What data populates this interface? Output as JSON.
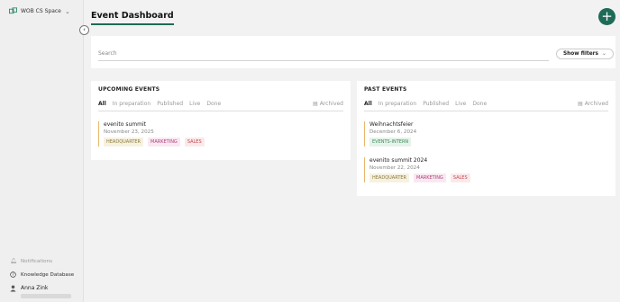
{
  "sidebar": {
    "workspace_name": "WOB CS Space",
    "links": {
      "notifications": "Notifications",
      "knowledge": "Knowledge Database"
    },
    "user": {
      "name": "Anna Zink"
    }
  },
  "header": {
    "title": "Event Dashboard"
  },
  "search": {
    "placeholder": "Search",
    "filters_label": "Show filters"
  },
  "upcoming": {
    "title": "UPCOMING EVENTS",
    "tabs": [
      "All",
      "In preparation",
      "Published",
      "Live",
      "Done"
    ],
    "archived_label": "Archived",
    "events": [
      {
        "title": "evenito summit",
        "date": "November 23, 2025",
        "tags": [
          "HEADQUARTER",
          "MARKETING",
          "SALES"
        ]
      }
    ]
  },
  "past": {
    "title": "PAST EVENTS",
    "tabs": [
      "All",
      "In preparation",
      "Published",
      "Live",
      "Done"
    ],
    "archived_label": "Archived",
    "events": [
      {
        "title": "Weihnachtsfeier",
        "date": "December 6, 2024",
        "tags": [
          "EVENTS-INTERN"
        ]
      },
      {
        "title": "evenito summit 2024",
        "date": "November 22, 2024",
        "tags": [
          "HEADQUARTER",
          "MARKETING",
          "SALES"
        ]
      }
    ]
  },
  "colors": {
    "accent": "#1e6b57",
    "event_marker": "#e8b86a"
  }
}
